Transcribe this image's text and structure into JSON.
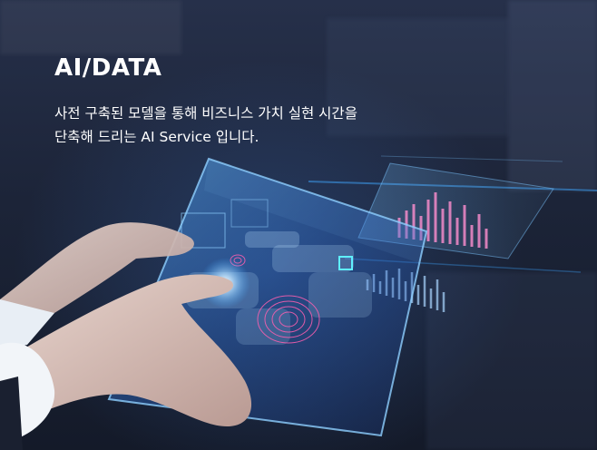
{
  "banner": {
    "title": "AI/DATA",
    "description_line1": "사전 구축된 모델을 통해 비즈니스 가치 실현 시간을",
    "description_line2": "단축해 드리는 AI Service 입니다."
  },
  "colors": {
    "accent_glow": "#3fa7ff",
    "accent_pink": "#ff5fb0",
    "text": "#ffffff",
    "background": "#1c2438"
  }
}
